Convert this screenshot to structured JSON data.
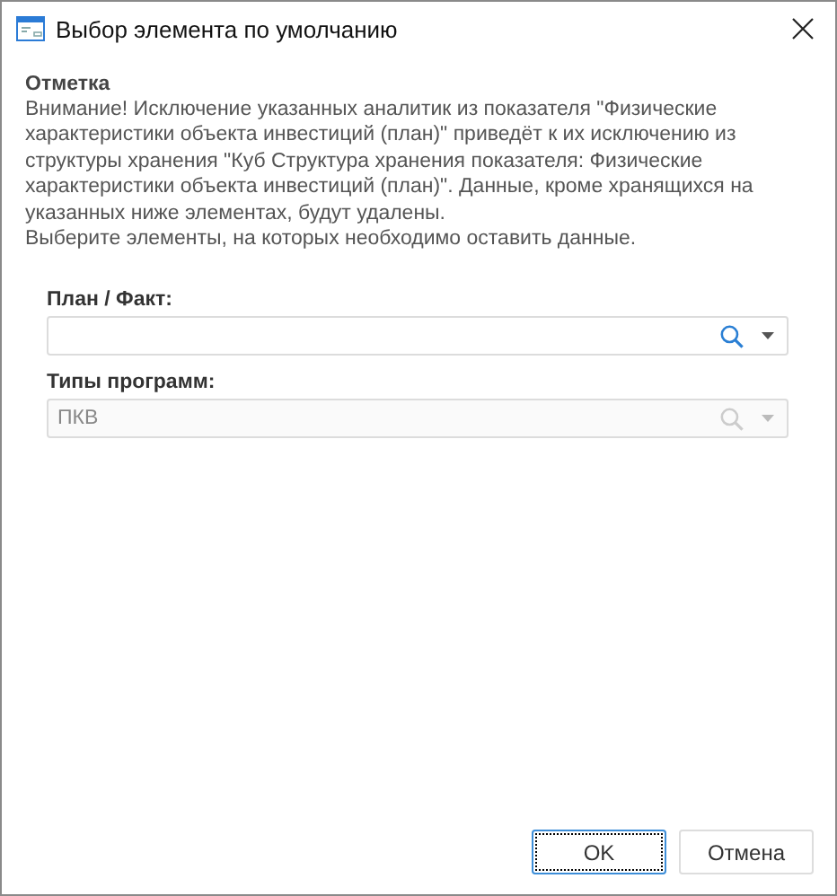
{
  "window": {
    "title": "Выбор элемента по умолчанию"
  },
  "note": {
    "title": "Отметка",
    "paragraphs": [
      "Внимание! Исключение указанных аналитик из показателя \"Физические характеристики объекта инвестиций (план)\" приведёт к их исключению из структуры хранения \"Куб Структура хранения показателя: Физические характеристики объекта инвестиций (план)\". Данные, кроме хранящихся на указанных ниже элементах, будут удалены.",
      "Выберите элементы, на которых необходимо оставить данные."
    ]
  },
  "fields": [
    {
      "label": "План / Факт:",
      "disabled": false
    },
    {
      "label": "Типы программ:",
      "value": "ПКВ",
      "disabled": true
    }
  ],
  "buttons": [
    {
      "label": "OK",
      "focused": true
    },
    {
      "label": "Отмена",
      "focused": false
    }
  ]
}
